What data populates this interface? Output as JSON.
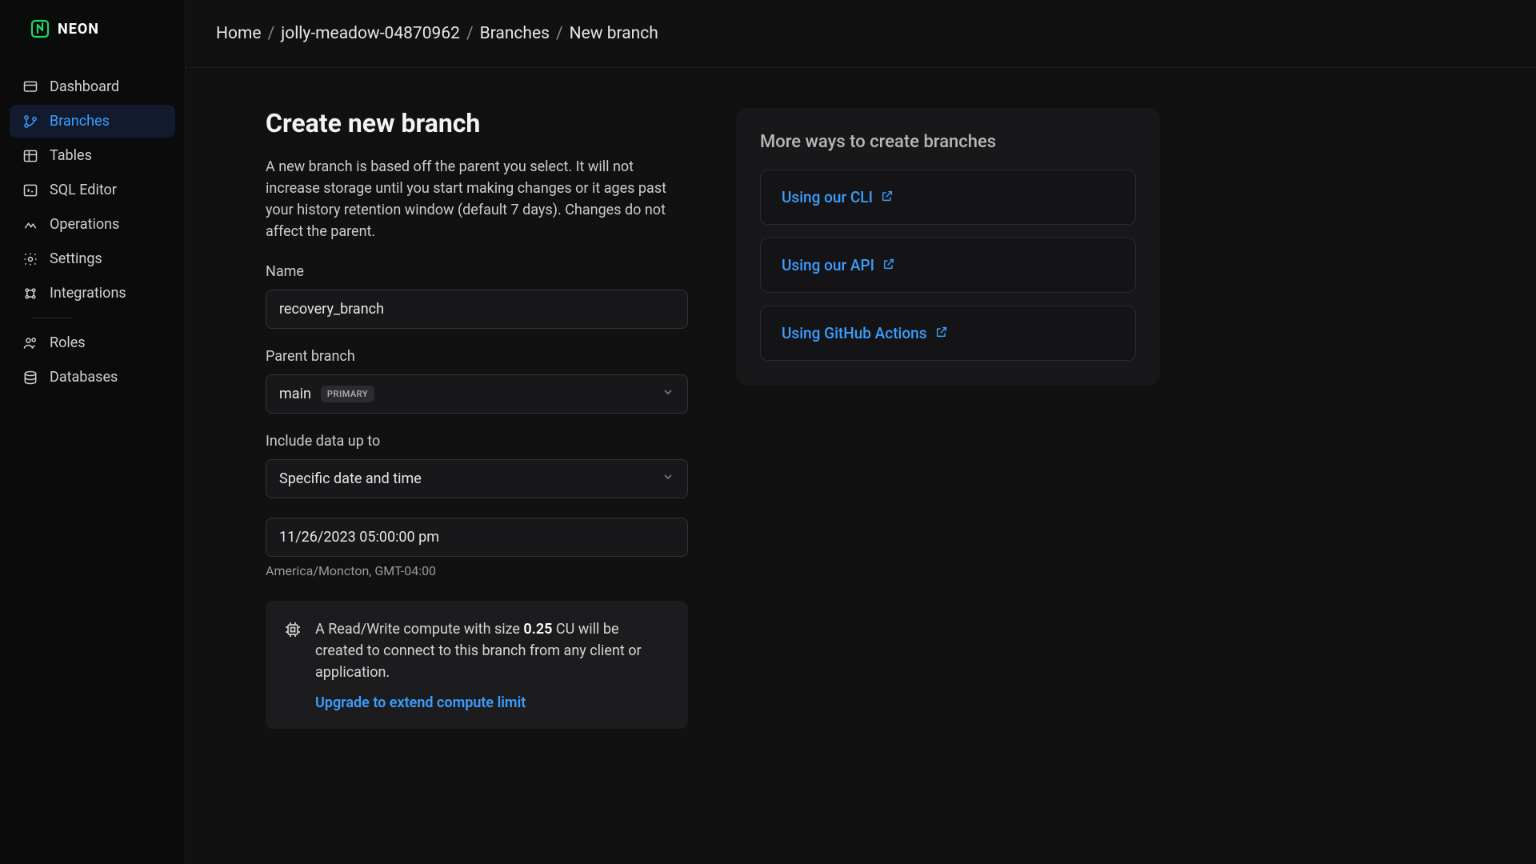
{
  "brand": {
    "name": "NEON"
  },
  "sidebar": {
    "items": [
      {
        "label": "Dashboard"
      },
      {
        "label": "Branches"
      },
      {
        "label": "Tables"
      },
      {
        "label": "SQL Editor"
      },
      {
        "label": "Operations"
      },
      {
        "label": "Settings"
      },
      {
        "label": "Integrations"
      },
      {
        "label": "Roles"
      },
      {
        "label": "Databases"
      }
    ]
  },
  "breadcrumb": {
    "home": "Home",
    "project": "jolly-meadow-04870962",
    "section": "Branches",
    "current": "New branch"
  },
  "form": {
    "title": "Create new branch",
    "description": "A new branch is based off the parent you select. It will not increase storage until you start making changes or it ages past your history retention window (default 7 days). Changes do not affect the parent.",
    "name_label": "Name",
    "name_value": "recovery_branch",
    "parent_label": "Parent branch",
    "parent_value": "main",
    "parent_badge": "PRIMARY",
    "include_label": "Include data up to",
    "include_value": "Specific date and time",
    "datetime_value": "11/26/2023 05:00:00 pm",
    "timezone": "America/Moncton, GMT-04:00",
    "compute_prefix": "A Read/Write compute with size ",
    "compute_size": "0.25",
    "compute_suffix": " CU will be created to connect to this branch from any client or application.",
    "upgrade_link": "Upgrade to extend compute limit"
  },
  "side": {
    "title": "More ways to create branches",
    "options": [
      {
        "label": "Using our CLI"
      },
      {
        "label": "Using our API"
      },
      {
        "label": "Using GitHub Actions"
      }
    ]
  }
}
